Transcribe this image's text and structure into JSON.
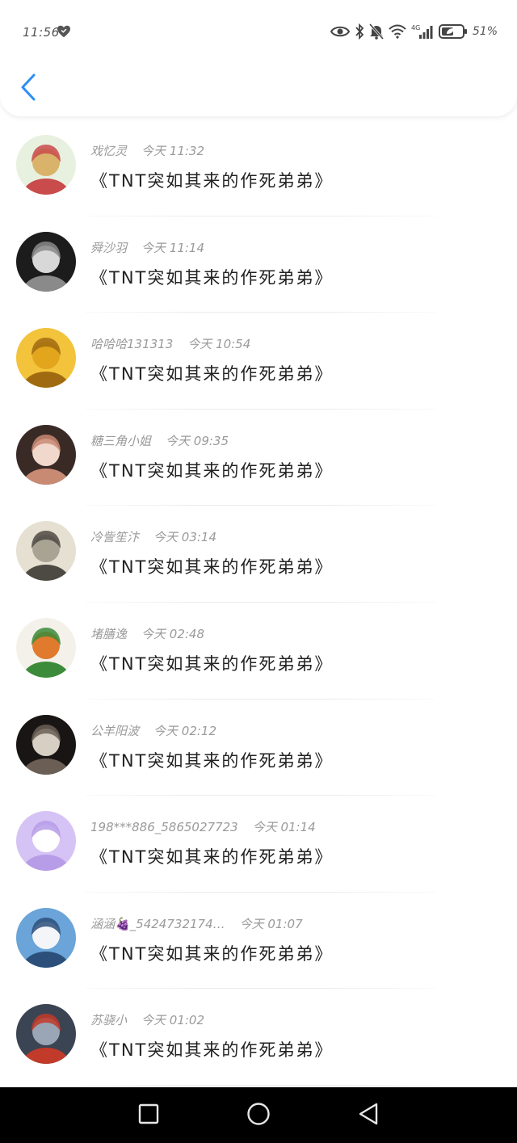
{
  "status_bar": {
    "time": "11:56",
    "battery_percent": "51%",
    "network": "4G",
    "icons": [
      "heart-icon",
      "eye-icon",
      "bluetooth-icon",
      "mute-icon",
      "wifi-icon",
      "signal-icon",
      "battery-icon"
    ]
  },
  "header": {
    "back_icon": "chevron-left-icon"
  },
  "items": [
    {
      "name": "戏忆灵",
      "time": "今天 11:32",
      "message": "《TNT突如其来的作死弟弟》",
      "avatar": {
        "bg": "#e8f1df",
        "fg": "#d9b36a",
        "accent": "#c94b4b"
      }
    },
    {
      "name": "舜沙羽",
      "time": "今天 11:14",
      "message": "《TNT突如其来的作死弟弟》",
      "avatar": {
        "bg": "#1c1c1c",
        "fg": "#d8d8d8",
        "accent": "#8a8a8a"
      }
    },
    {
      "name": "哈哈哈131313",
      "time": "今天 10:54",
      "message": "《TNT突如其来的作死弟弟》",
      "avatar": {
        "bg": "#f3c33c",
        "fg": "#e2a51c",
        "accent": "#a06b10"
      }
    },
    {
      "name": "糖三角小姐",
      "time": "今天 09:35",
      "message": "《TNT突如其来的作死弟弟》",
      "avatar": {
        "bg": "#3a2a25",
        "fg": "#f0d9cc",
        "accent": "#c98a73"
      }
    },
    {
      "name": "冷訾笙汴",
      "time": "今天 03:14",
      "message": "《TNT突如其来的作死弟弟》",
      "avatar": {
        "bg": "#e6e0d2",
        "fg": "#a9a394",
        "accent": "#4d4a44"
      }
    },
    {
      "name": "堵膳逸",
      "time": "今天 02:48",
      "message": "《TNT突如其来的作死弟弟》",
      "avatar": {
        "bg": "#f4f1ea",
        "fg": "#e07a2c",
        "accent": "#3c8b3a"
      }
    },
    {
      "name": "公羊阳波",
      "time": "今天 02:12",
      "message": "《TNT突如其来的作死弟弟》",
      "avatar": {
        "bg": "#1a1515",
        "fg": "#d8cfc4",
        "accent": "#6b5f55"
      }
    },
    {
      "name": "198***886_5865027723",
      "time": "今天 01:14",
      "message": "《TNT突如其来的作死弟弟》",
      "avatar": {
        "bg": "#d6c3f5",
        "fg": "#ffffff",
        "accent": "#b79ce8"
      }
    },
    {
      "name": "涵涵🍇_5424732174…",
      "time": "今天 01:07",
      "message": "《TNT突如其来的作死弟弟》",
      "avatar": {
        "bg": "#6aa4d8",
        "fg": "#f3f5f8",
        "accent": "#2b4f7a"
      }
    },
    {
      "name": "苏骁小",
      "time": "今天 01:02",
      "message": "《TNT突如其来的作死弟弟》",
      "avatar": {
        "bg": "#3b4452",
        "fg": "#9aa6b6",
        "accent": "#c23a2a"
      }
    }
  ],
  "navbar": {
    "icons": [
      "recent-apps-icon",
      "home-icon",
      "back-triangle-icon"
    ]
  },
  "colors": {
    "accent": "#2b8ff5",
    "meta_text": "#9a9a9a",
    "message_text": "#222222"
  }
}
